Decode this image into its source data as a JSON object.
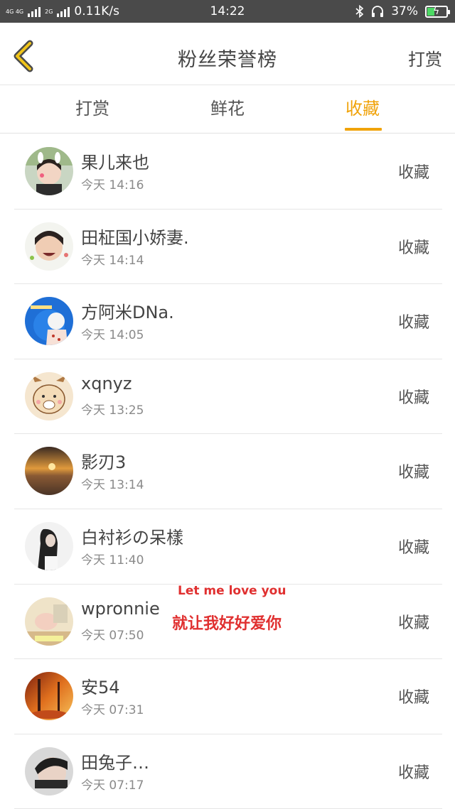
{
  "status_bar": {
    "network1": "4G 4G",
    "network2": "2G",
    "speed": "0.11K/s",
    "time": "14:22",
    "battery": "37%",
    "battery_level": 0.37
  },
  "header": {
    "title": "粉丝荣誉榜",
    "action_label": "打赏"
  },
  "tabs": [
    {
      "label": "打赏",
      "active": false
    },
    {
      "label": "鲜花",
      "active": false
    },
    {
      "label": "收藏",
      "active": true
    }
  ],
  "accent_color": "#f0a30a",
  "rows": [
    {
      "name": "果儿来也",
      "time": "今天  14:16",
      "action": "收藏"
    },
    {
      "name": "田柾国小娇妻.",
      "time": "今天  14:14",
      "action": "收藏"
    },
    {
      "name": "方阿米DNa.",
      "time": "今天  14:05",
      "action": "收藏"
    },
    {
      "name": "xqnyz",
      "time": "今天  13:25",
      "action": "收藏"
    },
    {
      "name": "影刃3",
      "time": "今天  13:14",
      "action": "收藏"
    },
    {
      "name": "白衬衫の呆樣",
      "time": "今天  11:40",
      "action": "收藏"
    },
    {
      "name": "wpronnie",
      "time": "今天  07:50",
      "action": "收藏"
    },
    {
      "name": "安54",
      "time": "今天  07:31",
      "action": "收藏"
    },
    {
      "name": "田兔子…",
      "time": "今天  07:17",
      "action": "收藏"
    }
  ],
  "overlay": {
    "line1": "Let me love you",
    "line2": "就让我好好爱你"
  }
}
